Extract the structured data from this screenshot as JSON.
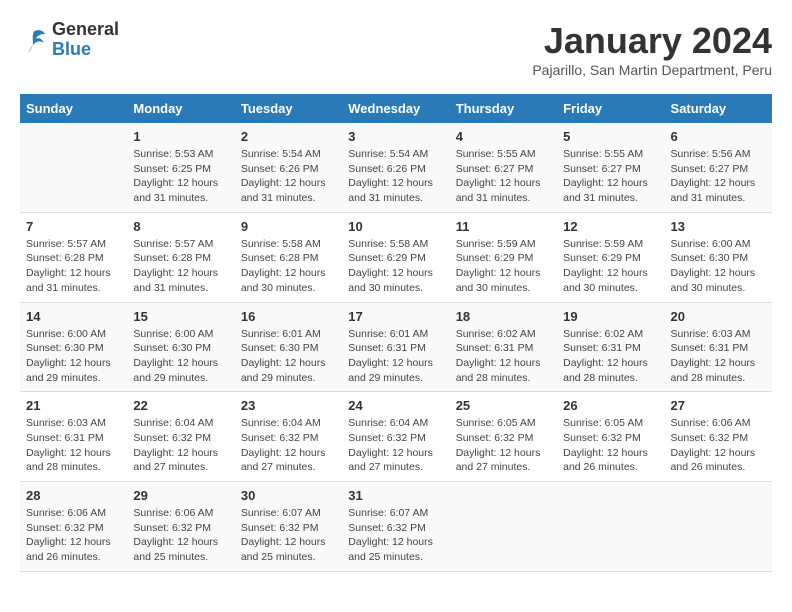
{
  "header": {
    "logo_general": "General",
    "logo_blue": "Blue",
    "month_title": "January 2024",
    "location": "Pajarillo, San Martin Department, Peru"
  },
  "days_of_week": [
    "Sunday",
    "Monday",
    "Tuesday",
    "Wednesday",
    "Thursday",
    "Friday",
    "Saturday"
  ],
  "weeks": [
    [
      {
        "day": "",
        "sunrise": "",
        "sunset": "",
        "daylight": ""
      },
      {
        "day": "1",
        "sunrise": "Sunrise: 5:53 AM",
        "sunset": "Sunset: 6:25 PM",
        "daylight": "Daylight: 12 hours and 31 minutes."
      },
      {
        "day": "2",
        "sunrise": "Sunrise: 5:54 AM",
        "sunset": "Sunset: 6:26 PM",
        "daylight": "Daylight: 12 hours and 31 minutes."
      },
      {
        "day": "3",
        "sunrise": "Sunrise: 5:54 AM",
        "sunset": "Sunset: 6:26 PM",
        "daylight": "Daylight: 12 hours and 31 minutes."
      },
      {
        "day": "4",
        "sunrise": "Sunrise: 5:55 AM",
        "sunset": "Sunset: 6:27 PM",
        "daylight": "Daylight: 12 hours and 31 minutes."
      },
      {
        "day": "5",
        "sunrise": "Sunrise: 5:55 AM",
        "sunset": "Sunset: 6:27 PM",
        "daylight": "Daylight: 12 hours and 31 minutes."
      },
      {
        "day": "6",
        "sunrise": "Sunrise: 5:56 AM",
        "sunset": "Sunset: 6:27 PM",
        "daylight": "Daylight: 12 hours and 31 minutes."
      }
    ],
    [
      {
        "day": "7",
        "sunrise": "Sunrise: 5:57 AM",
        "sunset": "Sunset: 6:28 PM",
        "daylight": "Daylight: 12 hours and 31 minutes."
      },
      {
        "day": "8",
        "sunrise": "Sunrise: 5:57 AM",
        "sunset": "Sunset: 6:28 PM",
        "daylight": "Daylight: 12 hours and 31 minutes."
      },
      {
        "day": "9",
        "sunrise": "Sunrise: 5:58 AM",
        "sunset": "Sunset: 6:28 PM",
        "daylight": "Daylight: 12 hours and 30 minutes."
      },
      {
        "day": "10",
        "sunrise": "Sunrise: 5:58 AM",
        "sunset": "Sunset: 6:29 PM",
        "daylight": "Daylight: 12 hours and 30 minutes."
      },
      {
        "day": "11",
        "sunrise": "Sunrise: 5:59 AM",
        "sunset": "Sunset: 6:29 PM",
        "daylight": "Daylight: 12 hours and 30 minutes."
      },
      {
        "day": "12",
        "sunrise": "Sunrise: 5:59 AM",
        "sunset": "Sunset: 6:29 PM",
        "daylight": "Daylight: 12 hours and 30 minutes."
      },
      {
        "day": "13",
        "sunrise": "Sunrise: 6:00 AM",
        "sunset": "Sunset: 6:30 PM",
        "daylight": "Daylight: 12 hours and 30 minutes."
      }
    ],
    [
      {
        "day": "14",
        "sunrise": "Sunrise: 6:00 AM",
        "sunset": "Sunset: 6:30 PM",
        "daylight": "Daylight: 12 hours and 29 minutes."
      },
      {
        "day": "15",
        "sunrise": "Sunrise: 6:00 AM",
        "sunset": "Sunset: 6:30 PM",
        "daylight": "Daylight: 12 hours and 29 minutes."
      },
      {
        "day": "16",
        "sunrise": "Sunrise: 6:01 AM",
        "sunset": "Sunset: 6:30 PM",
        "daylight": "Daylight: 12 hours and 29 minutes."
      },
      {
        "day": "17",
        "sunrise": "Sunrise: 6:01 AM",
        "sunset": "Sunset: 6:31 PM",
        "daylight": "Daylight: 12 hours and 29 minutes."
      },
      {
        "day": "18",
        "sunrise": "Sunrise: 6:02 AM",
        "sunset": "Sunset: 6:31 PM",
        "daylight": "Daylight: 12 hours and 28 minutes."
      },
      {
        "day": "19",
        "sunrise": "Sunrise: 6:02 AM",
        "sunset": "Sunset: 6:31 PM",
        "daylight": "Daylight: 12 hours and 28 minutes."
      },
      {
        "day": "20",
        "sunrise": "Sunrise: 6:03 AM",
        "sunset": "Sunset: 6:31 PM",
        "daylight": "Daylight: 12 hours and 28 minutes."
      }
    ],
    [
      {
        "day": "21",
        "sunrise": "Sunrise: 6:03 AM",
        "sunset": "Sunset: 6:31 PM",
        "daylight": "Daylight: 12 hours and 28 minutes."
      },
      {
        "day": "22",
        "sunrise": "Sunrise: 6:04 AM",
        "sunset": "Sunset: 6:32 PM",
        "daylight": "Daylight: 12 hours and 27 minutes."
      },
      {
        "day": "23",
        "sunrise": "Sunrise: 6:04 AM",
        "sunset": "Sunset: 6:32 PM",
        "daylight": "Daylight: 12 hours and 27 minutes."
      },
      {
        "day": "24",
        "sunrise": "Sunrise: 6:04 AM",
        "sunset": "Sunset: 6:32 PM",
        "daylight": "Daylight: 12 hours and 27 minutes."
      },
      {
        "day": "25",
        "sunrise": "Sunrise: 6:05 AM",
        "sunset": "Sunset: 6:32 PM",
        "daylight": "Daylight: 12 hours and 27 minutes."
      },
      {
        "day": "26",
        "sunrise": "Sunrise: 6:05 AM",
        "sunset": "Sunset: 6:32 PM",
        "daylight": "Daylight: 12 hours and 26 minutes."
      },
      {
        "day": "27",
        "sunrise": "Sunrise: 6:06 AM",
        "sunset": "Sunset: 6:32 PM",
        "daylight": "Daylight: 12 hours and 26 minutes."
      }
    ],
    [
      {
        "day": "28",
        "sunrise": "Sunrise: 6:06 AM",
        "sunset": "Sunset: 6:32 PM",
        "daylight": "Daylight: 12 hours and 26 minutes."
      },
      {
        "day": "29",
        "sunrise": "Sunrise: 6:06 AM",
        "sunset": "Sunset: 6:32 PM",
        "daylight": "Daylight: 12 hours and 25 minutes."
      },
      {
        "day": "30",
        "sunrise": "Sunrise: 6:07 AM",
        "sunset": "Sunset: 6:32 PM",
        "daylight": "Daylight: 12 hours and 25 minutes."
      },
      {
        "day": "31",
        "sunrise": "Sunrise: 6:07 AM",
        "sunset": "Sunset: 6:32 PM",
        "daylight": "Daylight: 12 hours and 25 minutes."
      },
      {
        "day": "",
        "sunrise": "",
        "sunset": "",
        "daylight": ""
      },
      {
        "day": "",
        "sunrise": "",
        "sunset": "",
        "daylight": ""
      },
      {
        "day": "",
        "sunrise": "",
        "sunset": "",
        "daylight": ""
      }
    ]
  ]
}
